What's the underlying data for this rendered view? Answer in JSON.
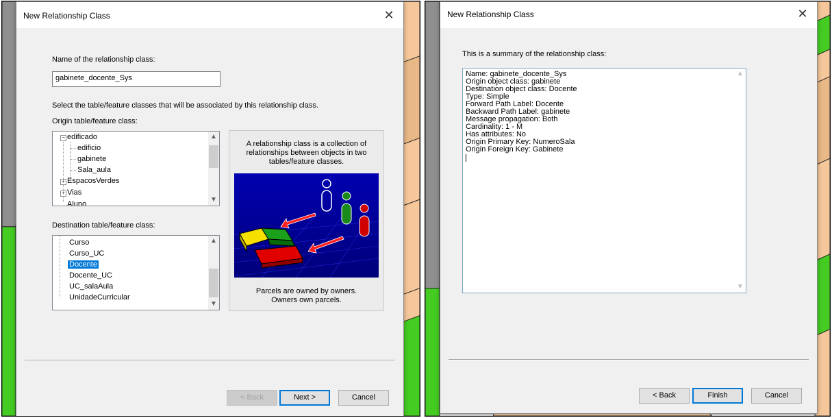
{
  "left_dialog": {
    "title": "New Relationship Class",
    "name_label": "Name of the relationship class:",
    "name_value": "gabinete_docente_Sys",
    "select_instruction": "Select the table/feature classes that will be associated by this relationship class.",
    "origin_label": "Origin table/feature class:",
    "origin_tree": [
      "edificado",
      "edificio",
      "gabinete",
      "Sala_aula",
      "EspacosVerdes",
      "Vias",
      "Aluno"
    ],
    "origin_selected": "gabinete",
    "destination_label": "Destination table/feature class:",
    "destination_list": [
      "Curso",
      "Curso_UC",
      "Docente",
      "Docente_UC",
      "UC_salaAula",
      "UnidadeCurricular"
    ],
    "destination_selected": "Docente",
    "info_top": [
      "A relationship class is a collection of",
      "relationships between objects in two",
      "tables/feature classes."
    ],
    "info_bottom": [
      "Parcels are owned by owners.",
      "Owners own parcels."
    ],
    "buttons": {
      "back": "< Back",
      "next": "Next >",
      "cancel": "Cancel"
    }
  },
  "right_dialog": {
    "title": "New Relationship Class",
    "summary_label": "This is a summary of the relationship class:",
    "summary_lines": [
      "Name: gabinete_docente_Sys",
      "Origin object class: gabinete",
      "Destination object class: Docente",
      "Type: Simple",
      "Forward Path Label: Docente",
      "Backward Path Label: gabinete",
      "Message propagation: Both",
      "Cardinality: 1 - M",
      "Has attributes: No",
      "Origin Primary Key: NumeroSala",
      "Origin Foreign Key: Gabinete"
    ],
    "buttons": {
      "back": "< Back",
      "finish": "Finish",
      "cancel": "Cancel"
    }
  },
  "icons": {
    "close": "close-icon",
    "expand": "plus-icon",
    "collapse": "minus-icon",
    "scroll_up": "chevron-up-icon",
    "scroll_down": "chevron-down-icon"
  },
  "colors": {
    "accent": "#0078d7",
    "map_red": "#e00000",
    "map_green": "#44cc22",
    "map_orange": "#f6c79a",
    "map_gray": "#8a8a8a",
    "map_yellow": "#f0e090"
  }
}
